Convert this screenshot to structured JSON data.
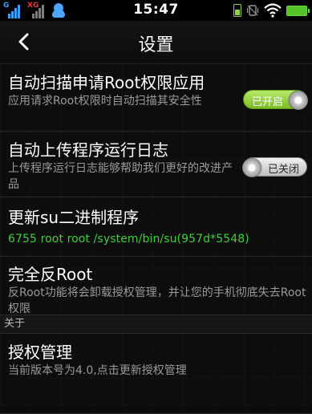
{
  "status_bar": {
    "network1_label": "G",
    "network2_label": "XG",
    "time": "15:47",
    "colors": {
      "signal_active": "#3aa0ff",
      "signal_inactive": "#7d7d7d",
      "battery": "#55c22a"
    },
    "icons": [
      "signal-icon",
      "signal-no-data-icon",
      "qq-icon",
      "battery-small-icon",
      "vibrate-icon",
      "wifi-icon",
      "battery-icon"
    ]
  },
  "header": {
    "back_icon": "chevron-left-icon",
    "title": "设置"
  },
  "settings": {
    "auto_scan": {
      "title": "自动扫描申请Root权限应用",
      "description": "应用请求Root权限时自动扫描其安全性",
      "toggle_label": "已开启",
      "enabled": true
    },
    "upload_log": {
      "title": "自动上传程序运行日志",
      "description": "上传程序运行日志能够帮助我们更好的改进产品",
      "toggle_label": "已关闭",
      "enabled": false
    },
    "update_su": {
      "title": "更新su二进制程序",
      "info": "6755  root  root  /system/bin/su(957d*5548)"
    },
    "unroot": {
      "title": "完全反Root",
      "description": "反Root功能将会卸载授权管理，并让您的手机彻底失去Root权限"
    }
  },
  "about_section": {
    "label": "关于",
    "auth_manager": {
      "title": "授权管理",
      "description": "当前版本号为4.0,点击更新授权管理"
    }
  },
  "colors": {
    "toggle_on": "#7cbc24",
    "toggle_off": "#bdbdbd",
    "info_green": "#3fcf3a",
    "secondary_text": "#9a9a9a"
  }
}
